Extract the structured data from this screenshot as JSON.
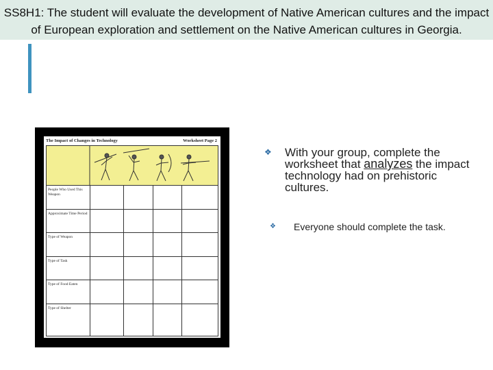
{
  "slide": {
    "title": "SS8H1: The student will evaluate the development of Native American cultures and the impact of European exploration and settlement on the Native American cultures in Georgia."
  },
  "worksheet": {
    "header_left": "The Impact of Changes in Technology",
    "header_right": "Worksheet Page 2",
    "row_labels": [
      "People Who Used This Weapon",
      "Approximate Time Period",
      "Type of Weapon",
      "Type of Task",
      "Type of Food Eaten",
      "Type of Shelter"
    ]
  },
  "bullets": {
    "main_before": "With your group, complete the worksheet that ",
    "main_emphasis": "analyzes",
    "main_after": " the impact technology had on prehistoric cultures.",
    "sub": "Everyone should complete the task."
  },
  "colors": {
    "title_band": "#dfece6",
    "accent_bar": "#3f93bf",
    "bullet": "#2f6ea5",
    "image_row": "#f3ef93"
  }
}
